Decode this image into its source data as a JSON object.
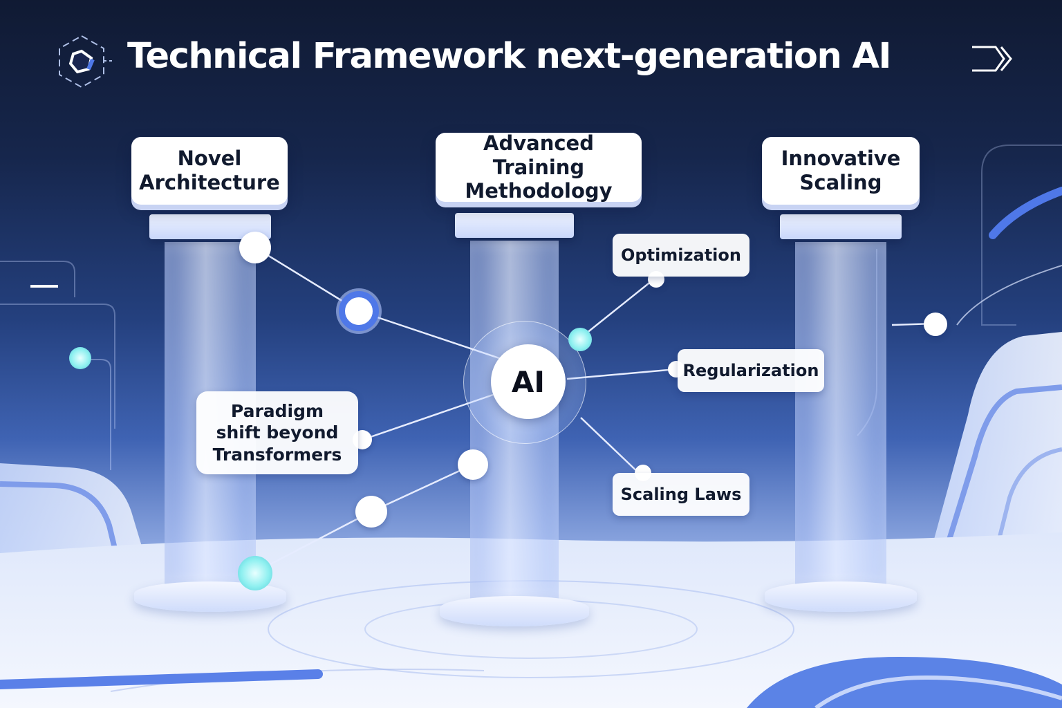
{
  "header": {
    "title": "Technical Framework next-generation AI"
  },
  "icons": {
    "logo": "hexagon-cube-icon",
    "nav": "double-chevron-right-icon"
  },
  "pillars": [
    {
      "label": "Novel\nArchitecture"
    },
    {
      "label": "Advanced Training\nMethodology"
    },
    {
      "label": "Innovative\nScaling"
    }
  ],
  "hub": {
    "label": "AI"
  },
  "concepts": {
    "paradigm": "Paradigm\nshift beyond\nTransformers",
    "optimization": "Optimization",
    "regularization": "Regularization",
    "scaling_laws": "Scaling Laws"
  },
  "colors": {
    "background_top": "#101a33",
    "accent_blue": "#4f78e8",
    "accent_cyan": "#8ff0f0",
    "card": "#ffffff"
  }
}
